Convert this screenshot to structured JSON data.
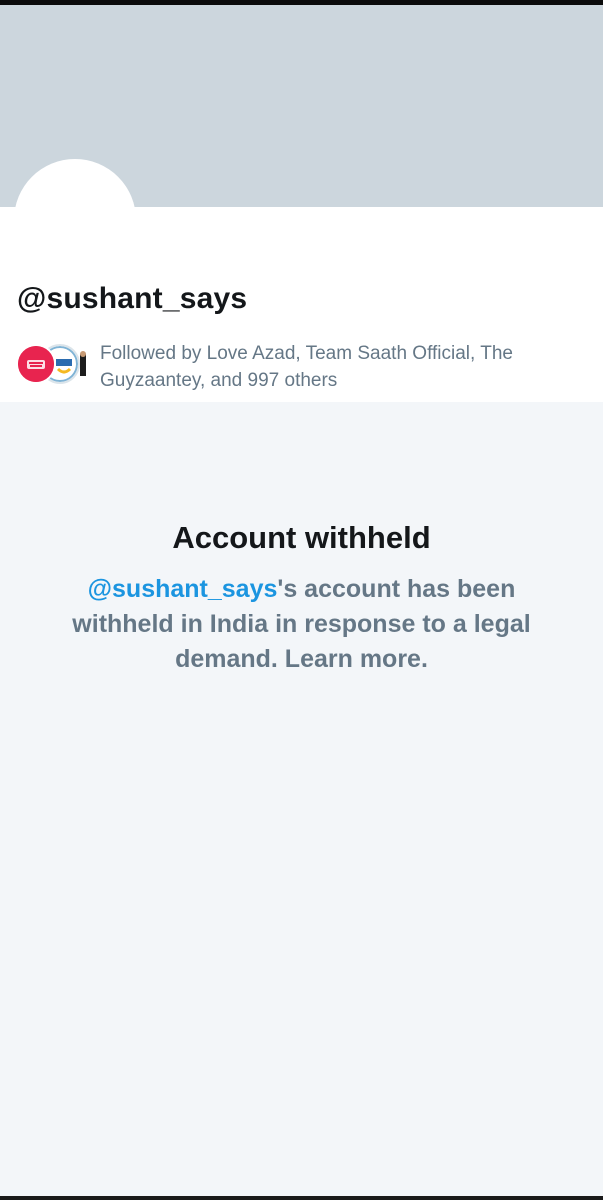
{
  "profile": {
    "handle": "@sushant_says",
    "followed_by_text": "Followed by Love Azad, Team Saath Official, The Guyzaantey, and 997 others",
    "follower_avatars": [
      "love-azad-avatar",
      "team-saath-avatar",
      "guyzaantey-avatar"
    ]
  },
  "withheld": {
    "title": "Account withheld",
    "handle_link": "@sushant_says",
    "message": "'s account has been withheld in India in response to a legal demand. Learn more."
  },
  "colors": {
    "banner": "#ccd6dd",
    "page_bg": "#f3f6f9",
    "link": "#1b95e0",
    "secondary_text": "#657786",
    "primary_text": "#14171a"
  }
}
